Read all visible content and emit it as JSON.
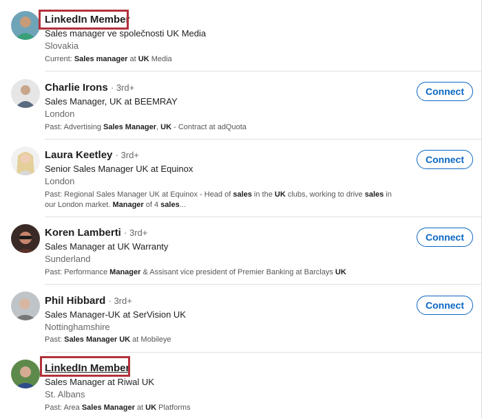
{
  "results": [
    {
      "name": "LinkedIn Member",
      "degree": "",
      "headline": "Sales manager ve společnosti UK Media",
      "location": "Slovakia",
      "snippet_label": "Current:",
      "snippet_parts": [
        {
          "text": " ",
          "bold": false
        },
        {
          "text": "Sales manager",
          "bold": true
        },
        {
          "text": " at ",
          "bold": false
        },
        {
          "text": "UK",
          "bold": true
        },
        {
          "text": " Media",
          "bold": false
        }
      ],
      "connect_label": "",
      "highlighted": true
    },
    {
      "name": "Charlie Irons",
      "degree": "· 3rd+",
      "headline": "Sales Manager, UK at BEEMRAY",
      "location": "London",
      "snippet_label": "Past:",
      "snippet_parts": [
        {
          "text": " Advertising ",
          "bold": false
        },
        {
          "text": "Sales Manager",
          "bold": true
        },
        {
          "text": ", ",
          "bold": false
        },
        {
          "text": "UK",
          "bold": true
        },
        {
          "text": " - Contract at adQuota",
          "bold": false
        }
      ],
      "connect_label": "Connect",
      "highlighted": false
    },
    {
      "name": "Laura Keetley",
      "degree": "· 3rd+",
      "headline": "Senior Sales Manager UK at Equinox",
      "location": "London",
      "snippet_label": "Past:",
      "snippet_parts": [
        {
          "text": " Regional Sales Manager UK at Equinox - Head of ",
          "bold": false
        },
        {
          "text": "sales",
          "bold": true
        },
        {
          "text": " in the ",
          "bold": false
        },
        {
          "text": "UK",
          "bold": true
        },
        {
          "text": " clubs, working to drive ",
          "bold": false
        },
        {
          "text": "sales",
          "bold": true
        },
        {
          "text": " in our London market. ",
          "bold": false
        },
        {
          "text": "Manager",
          "bold": true
        },
        {
          "text": " of 4 ",
          "bold": false
        },
        {
          "text": "sales",
          "bold": true
        },
        {
          "text": "...",
          "bold": false
        }
      ],
      "connect_label": "Connect",
      "highlighted": false
    },
    {
      "name": "Koren Lamberti",
      "degree": "· 3rd+",
      "headline": "Sales Manager at UK Warranty",
      "location": "Sunderland",
      "snippet_label": "Past:",
      "snippet_parts": [
        {
          "text": " Performance ",
          "bold": false
        },
        {
          "text": "Manager",
          "bold": true
        },
        {
          "text": " & Assisant vice president of Premier Banking at Barclays ",
          "bold": false
        },
        {
          "text": "UK",
          "bold": true
        }
      ],
      "connect_label": "Connect",
      "highlighted": false
    },
    {
      "name": "Phil Hibbard",
      "degree": "· 3rd+",
      "headline": "Sales Manager-UK at SerVision UK",
      "location": "Nottinghamshire",
      "snippet_label": "Past:",
      "snippet_parts": [
        {
          "text": " ",
          "bold": false
        },
        {
          "text": "Sales Manager UK",
          "bold": true
        },
        {
          "text": " at Mobileye",
          "bold": false
        }
      ],
      "connect_label": "Connect",
      "highlighted": false
    },
    {
      "name": "LinkedIn Member",
      "degree": "",
      "headline": "Sales Manager at Riwal UK",
      "location": "St. Albans",
      "snippet_label": "Past:",
      "snippet_parts": [
        {
          "text": " Area ",
          "bold": false
        },
        {
          "text": "Sales Manager",
          "bold": true
        },
        {
          "text": " at ",
          "bold": false
        },
        {
          "text": "UK",
          "bold": true
        },
        {
          "text": " Platforms",
          "bold": false
        }
      ],
      "connect_label": "",
      "highlighted": true
    }
  ],
  "colors": {
    "accent": "#0a66c2",
    "highlight_box": "#b3303a"
  }
}
